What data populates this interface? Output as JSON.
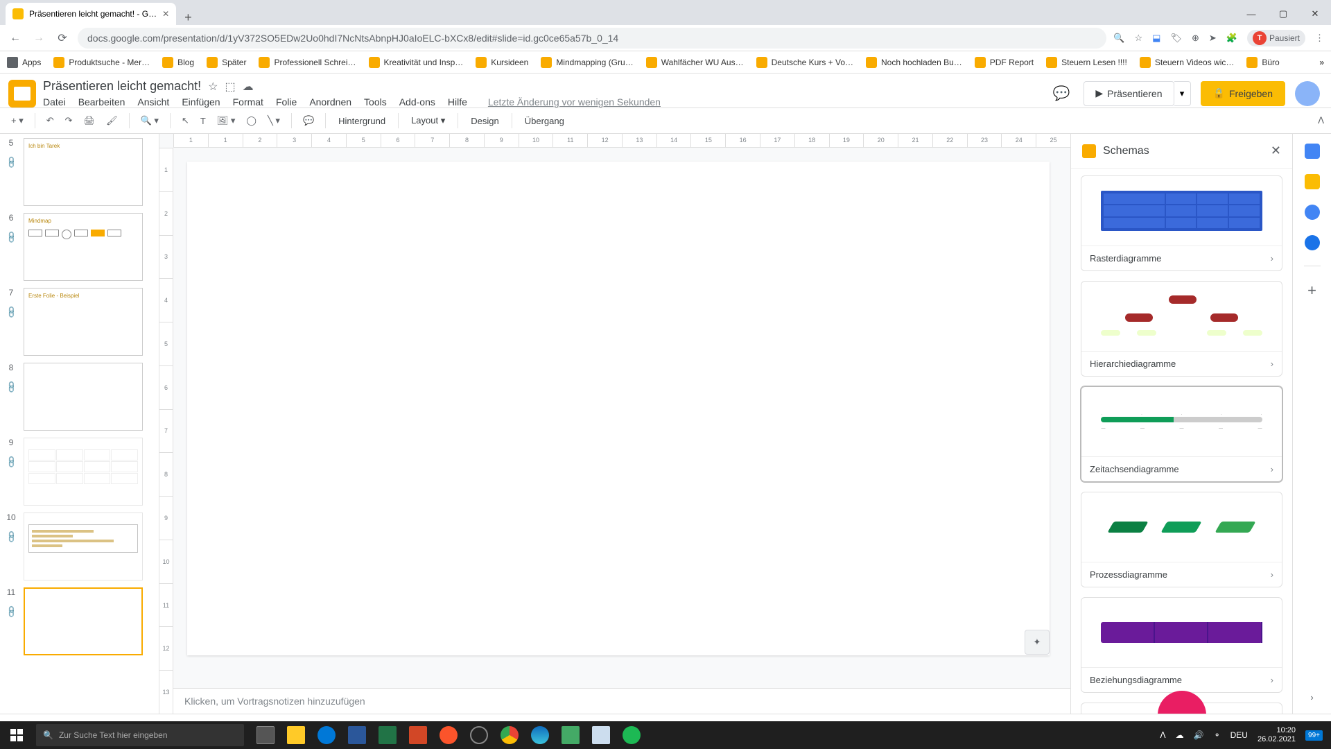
{
  "browser": {
    "tab_title": "Präsentieren leicht gemacht! - G…",
    "url": "docs.google.com/presentation/d/1yV372SO5EDw2Uo0hdI7NcNtsAbnpHJ0aIoELC-bXCx8/edit#slide=id.gc0ce65a57b_0_14",
    "profile_label": "Pausiert",
    "profile_initial": "T"
  },
  "bookmarks": [
    {
      "label": "Apps",
      "icon": "apps"
    },
    {
      "label": "Produktsuche - Mer…"
    },
    {
      "label": "Blog"
    },
    {
      "label": "Später"
    },
    {
      "label": "Professionell Schrei…"
    },
    {
      "label": "Kreativität und Insp…"
    },
    {
      "label": "Kursideen"
    },
    {
      "label": "Mindmapping (Gru…"
    },
    {
      "label": "Wahlfächer WU Aus…"
    },
    {
      "label": "Deutsche Kurs + Vo…"
    },
    {
      "label": "Noch hochladen Bu…"
    },
    {
      "label": "PDF Report"
    },
    {
      "label": "Steuern Lesen !!!!"
    },
    {
      "label": "Steuern Videos wic…"
    },
    {
      "label": "Büro"
    }
  ],
  "doc": {
    "title": "Präsentieren leicht gemacht!",
    "last_edit": "Letzte Änderung vor wenigen Sekunden"
  },
  "menu": [
    "Datei",
    "Bearbeiten",
    "Ansicht",
    "Einfügen",
    "Format",
    "Folie",
    "Anordnen",
    "Tools",
    "Add-ons",
    "Hilfe"
  ],
  "header_buttons": {
    "present": "Präsentieren",
    "share": "Freigeben"
  },
  "toolbar": {
    "background": "Hintergrund",
    "layout": "Layout",
    "design": "Design",
    "transition": "Übergang"
  },
  "ruler_h": [
    "1",
    "1",
    "2",
    "3",
    "4",
    "5",
    "6",
    "7",
    "8",
    "9",
    "10",
    "11",
    "12",
    "13",
    "14",
    "15",
    "16",
    "17",
    "18",
    "19",
    "20",
    "21",
    "22",
    "23",
    "24",
    "25"
  ],
  "ruler_v": [
    "1",
    "2",
    "3",
    "4",
    "5",
    "6",
    "7",
    "8",
    "9",
    "10",
    "11",
    "12",
    "13"
  ],
  "thumbs": [
    {
      "num": "5",
      "text": "Ich bin Tarek",
      "selected": false
    },
    {
      "num": "6",
      "text": "Mindmap",
      "selected": false,
      "has_boxes": true
    },
    {
      "num": "7",
      "text": "Erste Folie - Beispiel",
      "selected": false
    },
    {
      "num": "8",
      "text": "",
      "selected": false
    },
    {
      "num": "9",
      "text": "",
      "selected": false,
      "dim": true,
      "has_table": true
    },
    {
      "num": "10",
      "text": "",
      "selected": false,
      "dim": true,
      "has_chart": true
    },
    {
      "num": "11",
      "text": "",
      "selected": true
    }
  ],
  "notes_placeholder": "Klicken, um Vortragsnotizen hinzuzufügen",
  "schema": {
    "title": "Schemas",
    "cards": [
      {
        "label": "Rasterdiagramme",
        "type": "grid"
      },
      {
        "label": "Hierarchiediagramme",
        "type": "hier"
      },
      {
        "label": "Zeitachsendiagramme",
        "type": "time",
        "hover": true
      },
      {
        "label": "Prozessdiagramme",
        "type": "proc"
      },
      {
        "label": "Beziehungsdiagramme",
        "type": "rel"
      }
    ]
  },
  "taskbar": {
    "search_placeholder": "Zur Suche Text hier eingeben",
    "lang": "DEU",
    "time": "10:20",
    "date": "26.02.2021",
    "notif": "99+"
  }
}
